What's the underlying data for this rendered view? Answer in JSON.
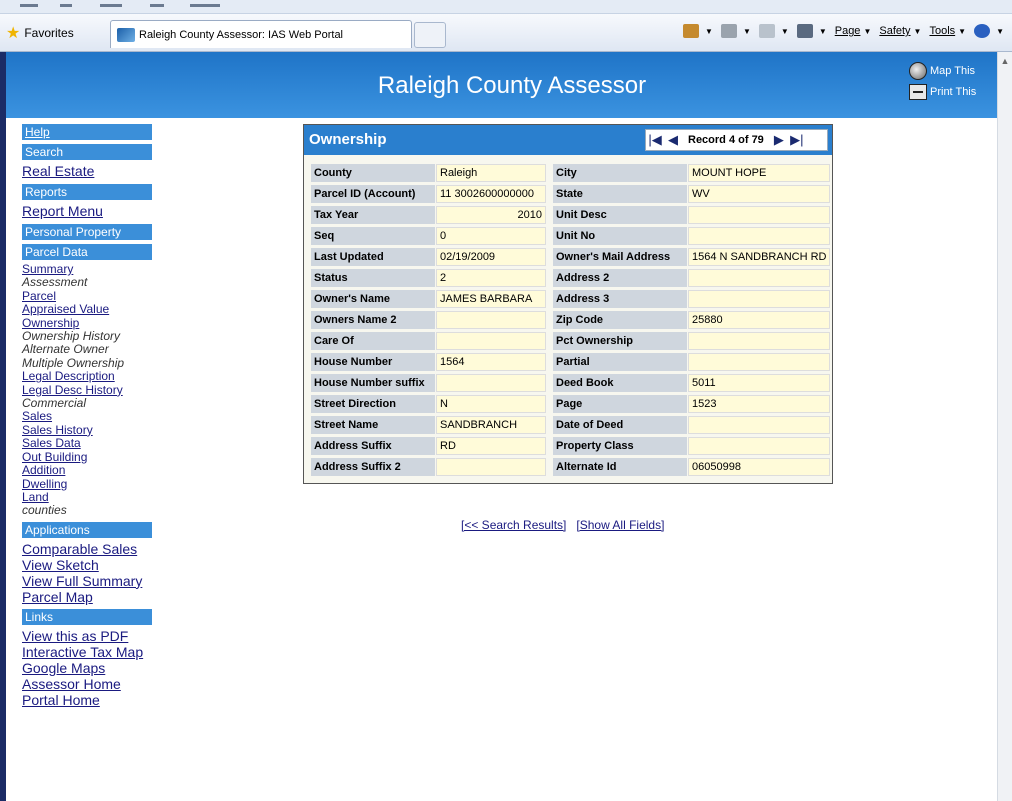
{
  "browser": {
    "favorites_label": "Favorites",
    "tab_title": "Raleigh County Assessor: IAS Web Portal",
    "cmd": {
      "page": "Page",
      "safety": "Safety",
      "tools": "Tools"
    }
  },
  "header": {
    "title": "Raleigh County Assessor",
    "map_this": "Map This",
    "print_this": "Print This"
  },
  "sidebar": {
    "help": "Help",
    "search_head": "Search",
    "real_estate": "Real Estate",
    "reports_head": "Reports",
    "report_menu": "Report Menu",
    "personal_property": "Personal Property",
    "parcel_data_head": "Parcel Data",
    "parcel_items": [
      {
        "label": "Summary",
        "link": true
      },
      {
        "label": "Assessment",
        "link": false
      },
      {
        "label": "Parcel",
        "link": true
      },
      {
        "label": "Appraised Value",
        "link": true
      },
      {
        "label": "Ownership",
        "link": true
      },
      {
        "label": "Ownership History",
        "link": false
      },
      {
        "label": "Alternate Owner",
        "link": false
      },
      {
        "label": "Multiple Ownership",
        "link": false
      },
      {
        "label": "Legal Description",
        "link": true
      },
      {
        "label": "Legal Desc History",
        "link": true
      },
      {
        "label": "Commercial",
        "link": false
      },
      {
        "label": "Sales",
        "link": true
      },
      {
        "label": "Sales History",
        "link": true
      },
      {
        "label": "Sales Data",
        "link": true
      },
      {
        "label": "Out Building",
        "link": true
      },
      {
        "label": "Addition",
        "link": true
      },
      {
        "label": "Dwelling",
        "link": true
      },
      {
        "label": "Land",
        "link": true
      },
      {
        "label": "counties",
        "link": false
      }
    ],
    "applications_head": "Applications",
    "applications": [
      "Comparable Sales",
      "View Sketch",
      "View Full Summary",
      "Parcel Map"
    ],
    "links_head": "Links",
    "links": [
      "View this as PDF",
      "Interactive Tax Map",
      "Google Maps",
      "Assessor Home",
      "Portal Home"
    ]
  },
  "panel": {
    "title": "Ownership",
    "record_label": "Record 4 of 79",
    "left_rows": [
      {
        "label": "County",
        "value": "Raleigh"
      },
      {
        "label": "Parcel ID (Account)",
        "value": "11  3002600000000"
      },
      {
        "label": "Tax Year",
        "value": "2010"
      },
      {
        "label": "Seq",
        "value": "0"
      },
      {
        "label": "Last Updated",
        "value": "02/19/2009"
      },
      {
        "label": "Status",
        "value": "2"
      },
      {
        "label": "Owner's Name",
        "value": "JAMES BARBARA"
      },
      {
        "label": "Owners Name 2",
        "value": ""
      },
      {
        "label": "Care Of",
        "value": ""
      },
      {
        "label": "House Number",
        "value": "1564"
      },
      {
        "label": "House Number suffix",
        "value": ""
      },
      {
        "label": "Street Direction",
        "value": "N"
      },
      {
        "label": "Street Name",
        "value": "SANDBRANCH"
      },
      {
        "label": "Address Suffix",
        "value": "RD"
      },
      {
        "label": "Address Suffix 2",
        "value": ""
      }
    ],
    "right_rows": [
      {
        "label": "City",
        "value": "MOUNT HOPE"
      },
      {
        "label": "State",
        "value": "WV"
      },
      {
        "label": "Unit Desc",
        "value": ""
      },
      {
        "label": "Unit No",
        "value": ""
      },
      {
        "label": "Owner's Mail Address",
        "value": "1564 N SANDBRANCH RD"
      },
      {
        "label": "Address 2",
        "value": ""
      },
      {
        "label": "Address 3",
        "value": ""
      },
      {
        "label": "Zip Code",
        "value": "25880"
      },
      {
        "label": "Pct Ownership",
        "value": ""
      },
      {
        "label": "Partial",
        "value": ""
      },
      {
        "label": "Deed Book",
        "value": "5011"
      },
      {
        "label": "Page",
        "value": "1523"
      },
      {
        "label": "Date of Deed",
        "value": ""
      },
      {
        "label": "Property Class",
        "value": ""
      },
      {
        "label": "Alternate Id",
        "value": "06050998"
      }
    ]
  },
  "footer": {
    "search_results": "[<< Search Results]",
    "show_all": "[Show All Fields]"
  },
  "colors": {
    "header_blue": "#2a7fce",
    "sidebar_head": "#3b8fd9",
    "label_bg": "#cfd6de",
    "value_bg": "#fffbd9",
    "link": "#1a1a80"
  }
}
